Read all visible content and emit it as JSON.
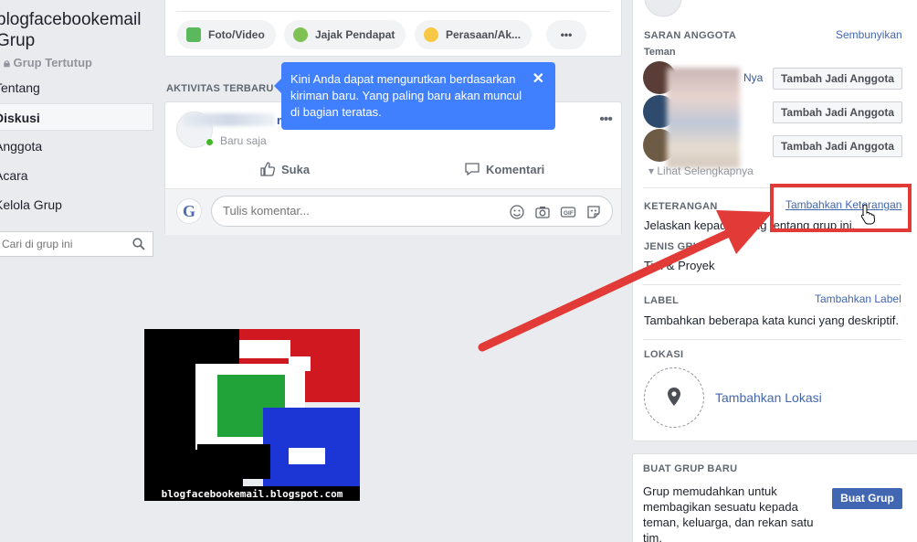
{
  "sidebar": {
    "group_name": "blogfacebookemail Grup",
    "group_type": "Grup Tertutup",
    "nav": [
      "Tentang",
      "Diskusi",
      "Anggota",
      "Acara",
      "Kelola Grup"
    ],
    "search_placeholder": "Cari di grup ini"
  },
  "composer": {
    "buttons": [
      "Foto/Video",
      "Jajak Pendapat",
      "Perasaan/Ak...",
      "•••"
    ]
  },
  "feed": {
    "section_label": "AKTIVITAS TERBARU",
    "tooltip": "Kini Anda dapat mengurutkan berdasarkan kiriman baru. Yang paling baru akan muncul di bagian teratas.",
    "tooltip_close": "✕",
    "post": {
      "name_suffix": "n",
      "time": "Baru saja",
      "more": "•••",
      "like_label": "Suka",
      "comment_label": "Komentari",
      "comment_placeholder": "Tulis komentar...",
      "avatar_letter": "G"
    }
  },
  "right": {
    "suggest_heading": "SARAN ANGGOTA",
    "hide_link": "Sembunyikan",
    "friends_label": "Teman",
    "member_suffix": "Nya",
    "add_member_label": "Tambah Jadi Anggota",
    "see_more": "Lihat Selengkapnya",
    "description_heading": "KETERANGAN",
    "add_description_link": "Tambahkan Keterangan",
    "description_text": "Jelaskan kepada orang tentang grup ini.",
    "type_heading": "JENIS GRUP",
    "type_value": "Tim & Proyek",
    "label_heading": "LABEL",
    "add_label_link": "Tambahkan Label",
    "label_text": "Tambahkan beberapa kata kunci yang deskriptif.",
    "location_heading": "LOKASI",
    "add_location": "Tambahkan Lokasi",
    "new_group_heading": "BUAT GRUP BARU",
    "new_group_text": "Grup memudahkan untuk membagikan sesuatu kepada teman, keluarga, dan rekan satu tim.",
    "new_group_button": "Buat Grup"
  },
  "watermark": {
    "text": "blogfacebookemail.blogspot.com"
  },
  "colors": {
    "accent": "#4267b2",
    "tooltip": "#4080ff",
    "annotation_red": "#e23a37",
    "online": "#42b72a"
  }
}
